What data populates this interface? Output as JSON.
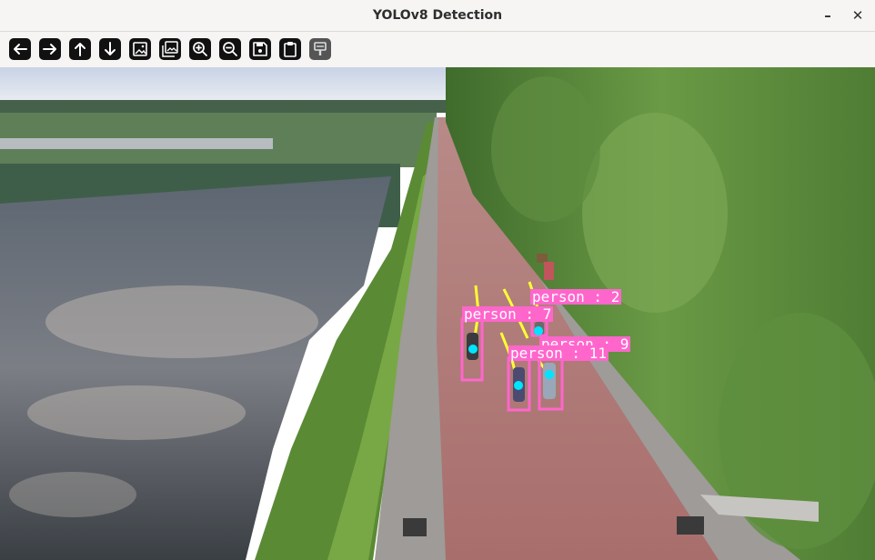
{
  "window": {
    "title": "YOLOv8 Detection"
  },
  "toolbar": {
    "buttons": [
      {
        "name": "back",
        "icon": "arrow-left-icon"
      },
      {
        "name": "forward",
        "icon": "arrow-right-icon"
      },
      {
        "name": "up",
        "icon": "arrow-up-icon"
      },
      {
        "name": "down",
        "icon": "arrow-down-icon"
      },
      {
        "name": "image",
        "icon": "image-icon"
      },
      {
        "name": "images",
        "icon": "images-icon"
      },
      {
        "name": "zoom-in",
        "icon": "zoom-in-icon"
      },
      {
        "name": "zoom-out",
        "icon": "zoom-out-icon"
      },
      {
        "name": "save",
        "icon": "save-icon"
      },
      {
        "name": "clipboard",
        "icon": "clipboard-icon"
      },
      {
        "name": "edit",
        "icon": "edit-icon"
      }
    ]
  },
  "detections": [
    {
      "label": "person : 2"
    },
    {
      "label": "person : 7"
    },
    {
      "label": "person : 9"
    },
    {
      "label": "person : 11"
    }
  ],
  "colors": {
    "box": "#ff66cc",
    "track": "#ffff33",
    "center": "#00e5ff"
  }
}
